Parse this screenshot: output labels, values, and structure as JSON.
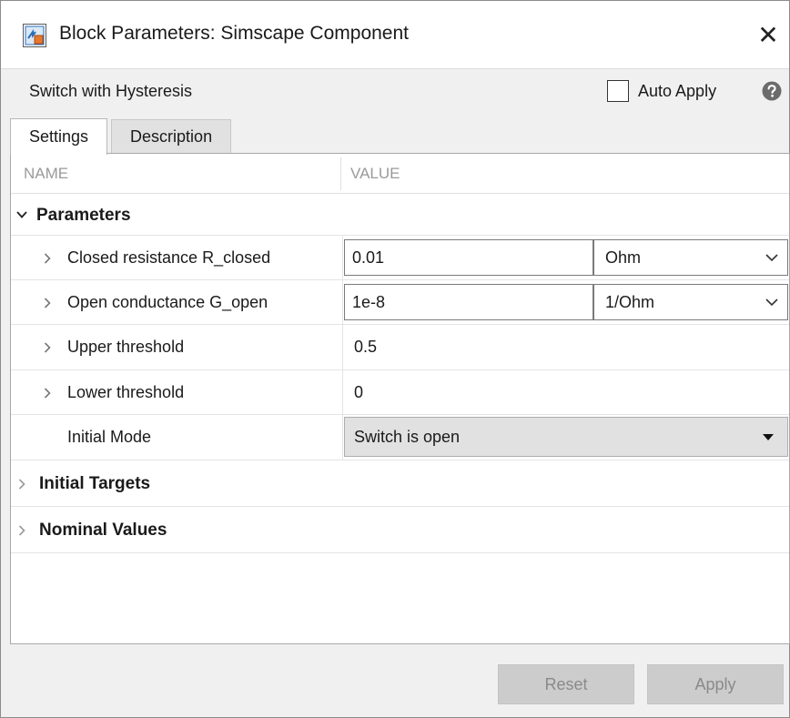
{
  "window": {
    "title": "Block Parameters: Simscape Component",
    "close_glyph": "✕"
  },
  "header": {
    "block_name": "Switch with Hysteresis",
    "auto_apply_label": "Auto Apply",
    "auto_apply_checked": false
  },
  "tabs": [
    {
      "label": "Settings",
      "active": true
    },
    {
      "label": "Description",
      "active": false
    }
  ],
  "table": {
    "col_name": "NAME",
    "col_value": "VALUE"
  },
  "sections": {
    "parameters": {
      "label": "Parameters",
      "expanded": true,
      "rows": [
        {
          "label": "Closed resistance R_closed",
          "value": "0.01",
          "unit": "Ohm"
        },
        {
          "label": "Open conductance G_open",
          "value": "1e-8",
          "unit": "1/Ohm"
        },
        {
          "label": "Upper threshold",
          "value": "0.5"
        },
        {
          "label": "Lower threshold",
          "value": "0"
        },
        {
          "label": "Initial Mode",
          "value": "Switch is open"
        }
      ]
    },
    "initial_targets": {
      "label": "Initial Targets",
      "expanded": false
    },
    "nominal_values": {
      "label": "Nominal Values",
      "expanded": false
    }
  },
  "footer": {
    "reset_label": "Reset",
    "apply_label": "Apply"
  },
  "icons": {
    "app": "simscape-block-icon",
    "help": "help-icon",
    "expand": "chevron-right-icon",
    "collapse": "chevron-down-icon",
    "dropdown": "dropdown-arrow-icon"
  },
  "colors": {
    "panel_bg": "#ffffff",
    "window_bg": "#f0f0f0",
    "disabled_button": "#cccccc",
    "icon_blue": "#2a6ebb",
    "icon_orange": "#e8772e"
  }
}
